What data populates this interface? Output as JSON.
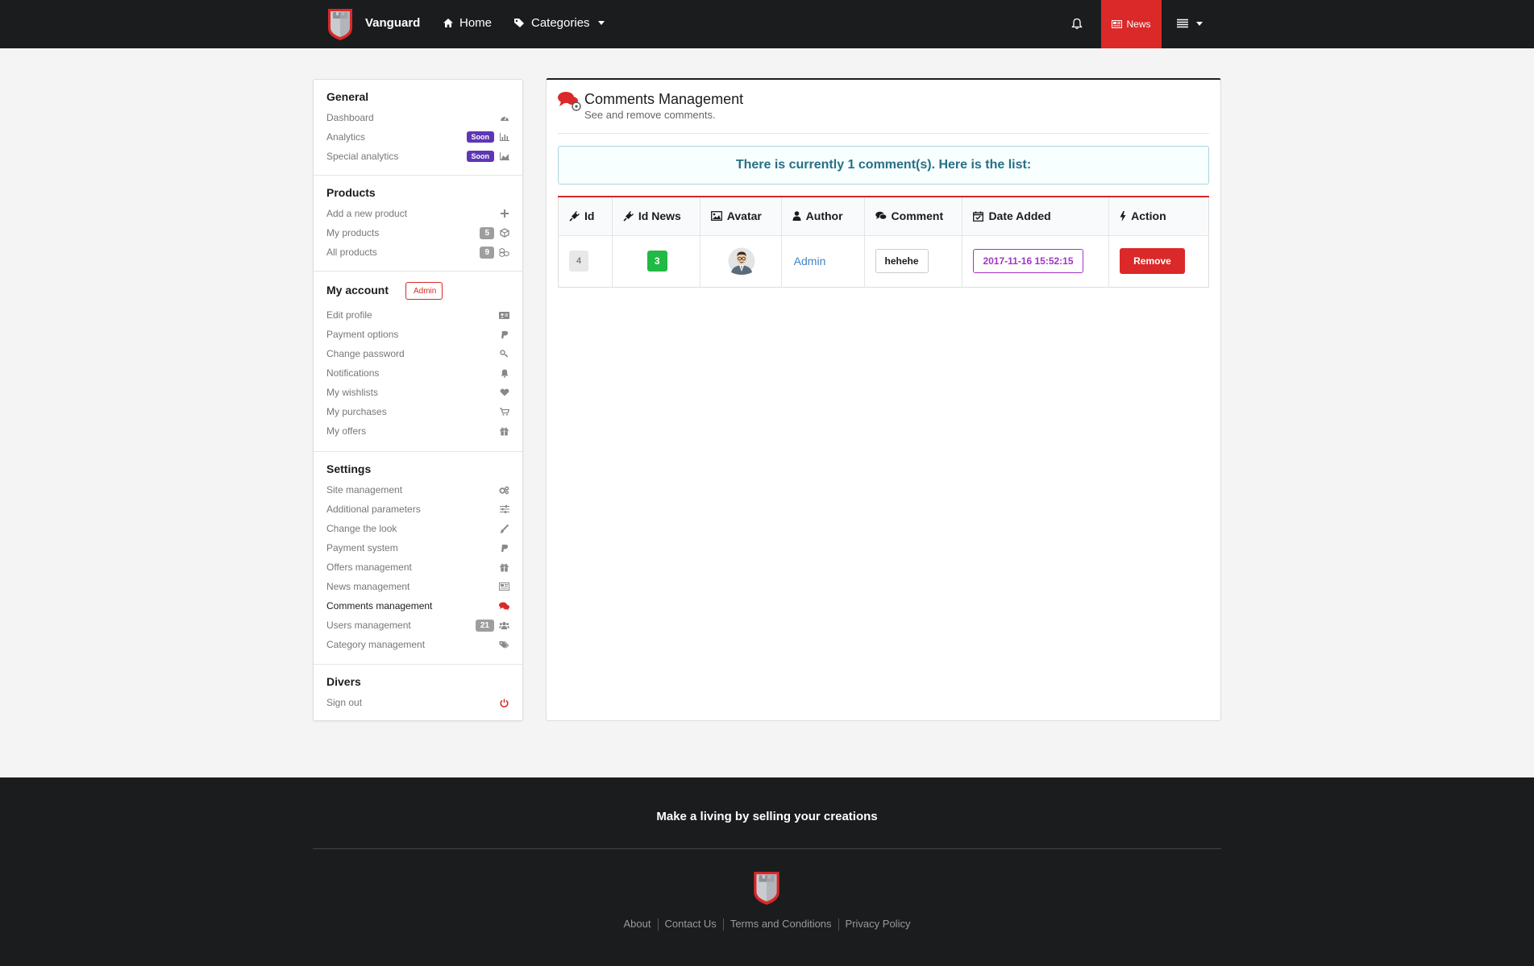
{
  "navbar": {
    "brand": "Vanguard",
    "home": "Home",
    "categories": "Categories",
    "news": "News"
  },
  "sidebar": {
    "general": {
      "title": "General",
      "items": [
        {
          "label": "Dashboard",
          "icon": "dashboard-icon"
        },
        {
          "label": "Analytics",
          "badge": "Soon",
          "icon": "bar-chart-icon"
        },
        {
          "label": "Special analytics",
          "badge": "Soon",
          "icon": "area-chart-icon"
        }
      ]
    },
    "products": {
      "title": "Products",
      "items": [
        {
          "label": "Add a new product",
          "icon": "plus-icon"
        },
        {
          "label": "My products",
          "count": "5",
          "icon": "cube-icon"
        },
        {
          "label": "All products",
          "count": "9",
          "icon": "cubes-icon"
        }
      ]
    },
    "account": {
      "title": "My account",
      "role": "Admin",
      "items": [
        {
          "label": "Edit profile",
          "icon": "id-card-icon"
        },
        {
          "label": "Payment options",
          "icon": "paypal-icon"
        },
        {
          "label": "Change password",
          "icon": "key-icon"
        },
        {
          "label": "Notifications",
          "icon": "bell-icon"
        },
        {
          "label": "My wishlists",
          "icon": "heart-icon"
        },
        {
          "label": "My purchases",
          "icon": "cart-icon"
        },
        {
          "label": "My offers",
          "icon": "gift-icon"
        }
      ]
    },
    "settings": {
      "title": "Settings",
      "items": [
        {
          "label": "Site management",
          "icon": "settings-icon"
        },
        {
          "label": "Additional parameters",
          "icon": "sliders-icon"
        },
        {
          "label": "Change the look",
          "icon": "paint-brush-icon"
        },
        {
          "label": "Payment system",
          "icon": "paypal-icon"
        },
        {
          "label": "Offers management",
          "icon": "gift-icon"
        },
        {
          "label": "News management",
          "icon": "newspaper-icon"
        },
        {
          "label": "Comments management",
          "icon": "comments-icon",
          "active": true
        },
        {
          "label": "Users management",
          "count": "21",
          "icon": "users-icon"
        },
        {
          "label": "Category management",
          "icon": "tags-icon"
        }
      ]
    },
    "divers": {
      "title": "Divers",
      "items": [
        {
          "label": "Sign out",
          "icon": "power-icon"
        }
      ]
    }
  },
  "main": {
    "title": "Comments Management",
    "subtitle": "See and remove comments.",
    "message": "There is currently 1 comment(s). Here is the list:",
    "table": {
      "headers": [
        "Id",
        "Id News",
        "Avatar",
        "Author",
        "Comment",
        "Date Added",
        "Action"
      ],
      "rows": [
        {
          "id": "4",
          "id_news": "3",
          "author": "Admin",
          "comment": "hehehe",
          "date": "2017-11-16 15:52:15",
          "action": "Remove"
        }
      ]
    }
  },
  "footer": {
    "tagline": "Make a living by selling your creations",
    "links": [
      "About",
      "Contact Us",
      "Terms and Conditions",
      "Privacy Policy"
    ]
  },
  "colors": {
    "accent": "#db2828",
    "dark": "#1b1c1d",
    "soon": "#5f36b5",
    "success": "#21ba45",
    "date": "#a333c8",
    "link": "#4183c4"
  }
}
